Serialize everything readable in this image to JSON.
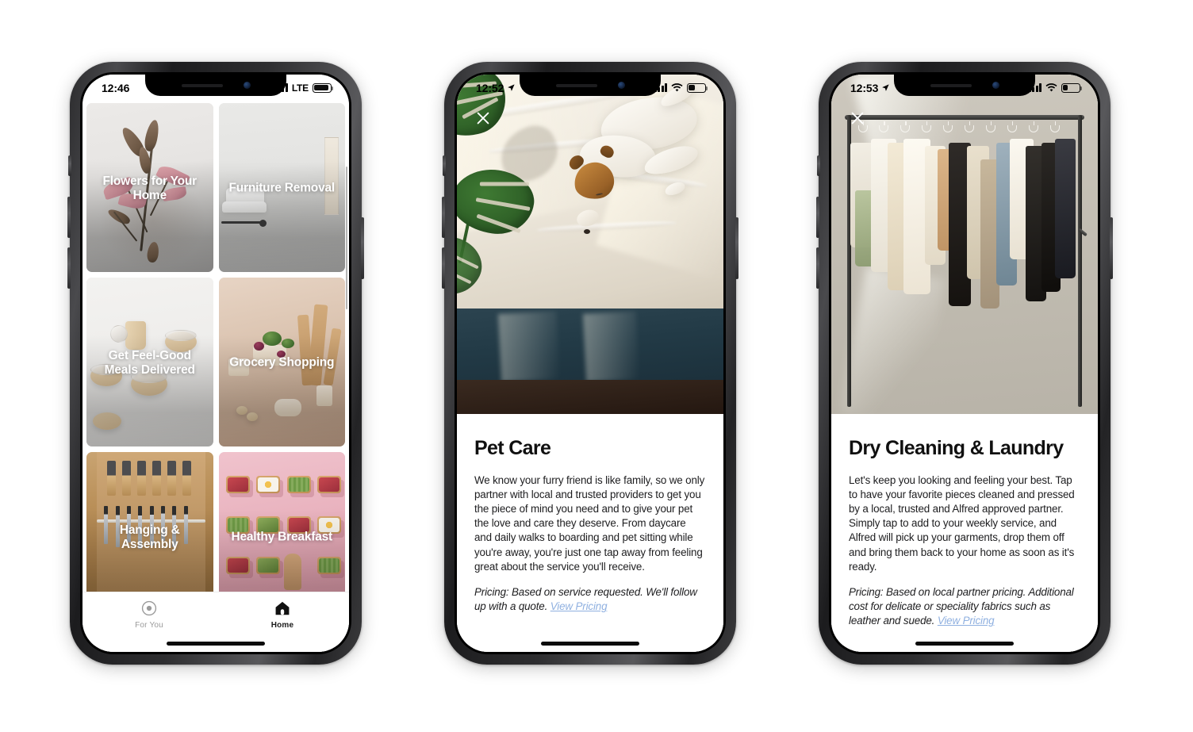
{
  "meta": {
    "app_name": "Alfred",
    "accent_link_color": "#8fb0e0",
    "active_tab_color": "#1a1a1a",
    "inactive_tab_color": "#9a9a9a"
  },
  "phones": [
    {
      "id": "phone-home-grid",
      "status_bar": {
        "time": "12:46",
        "location_arrow": false,
        "carrier_label": "LTE",
        "signal_icon": "signal-bars-icon",
        "wifi": false,
        "battery_icon": "battery-icon",
        "battery_level_pct": 92
      },
      "screen_type": "service-grid",
      "tiles": [
        {
          "label": "Flowers for Your Home",
          "art": "art-flowers",
          "name": "tile-flowers-for-your-home"
        },
        {
          "label": "Furniture Removal",
          "art": "art-furniture",
          "name": "tile-furniture-removal"
        },
        {
          "label": "Get Feel-Good Meals Delivered",
          "art": "art-meals",
          "name": "tile-get-feel-good-meals-delivered"
        },
        {
          "label": "Grocery Shopping",
          "art": "art-grocery",
          "name": "tile-grocery-shopping"
        },
        {
          "label": "Hanging & Assembly",
          "art": "art-tools",
          "name": "tile-hanging-and-assembly"
        },
        {
          "label": "Healthy Breakfast",
          "art": "art-breakfast",
          "name": "tile-healthy-breakfast"
        }
      ],
      "tab_bar": [
        {
          "label": "For You",
          "icon": "for-you-icon",
          "active": false
        },
        {
          "label": "Home",
          "icon": "home-icon",
          "active": true
        }
      ]
    },
    {
      "id": "phone-pet-care-detail",
      "status_bar": {
        "time": "12:52",
        "location_arrow": true,
        "carrier_label": "",
        "signal_icon": "signal-bars-icon",
        "wifi": true,
        "battery_icon": "battery-icon",
        "battery_level_pct": 38
      },
      "screen_type": "service-detail",
      "close_icon": "close-icon",
      "hero_art": "art-dog",
      "hero_alt": "sleeping dog on white bed with monstera plant",
      "title": "Pet Care",
      "description": "We know your furry friend is like family, so we only partner with local and trusted providers to get you the piece of mind you need and to give your pet the love and care they deserve. From daycare and daily walks to boarding and pet sitting while you're away, you're just one tap away from feeling great about the service you'll receive.",
      "pricing_text": "Pricing: Based on service requested. We'll follow up with a quote.",
      "pricing_link": "View Pricing"
    },
    {
      "id": "phone-dry-cleaning-detail",
      "status_bar": {
        "time": "12:53",
        "location_arrow": true,
        "carrier_label": "",
        "signal_icon": "signal-bars-icon",
        "wifi": true,
        "battery_icon": "battery-icon",
        "battery_level_pct": 30
      },
      "screen_type": "service-detail",
      "close_icon": "close-icon",
      "hero_art": "art-rack",
      "hero_alt": "clothing rack with neutral toned garments",
      "title": "Dry Cleaning & Laundry",
      "description": "Let's keep you looking and feeling your best. Tap to have your favorite pieces cleaned and pressed by a local, trusted and Alfred approved partner. Simply tap to add to your weekly service, and Alfred will pick up your garments, drop them off and bring them back to your home as soon as it's ready.",
      "pricing_text": "Pricing: Based on local partner pricing. Additional cost for delicate or speciality fabrics such as leather and suede.",
      "pricing_link": "View Pricing"
    }
  ]
}
